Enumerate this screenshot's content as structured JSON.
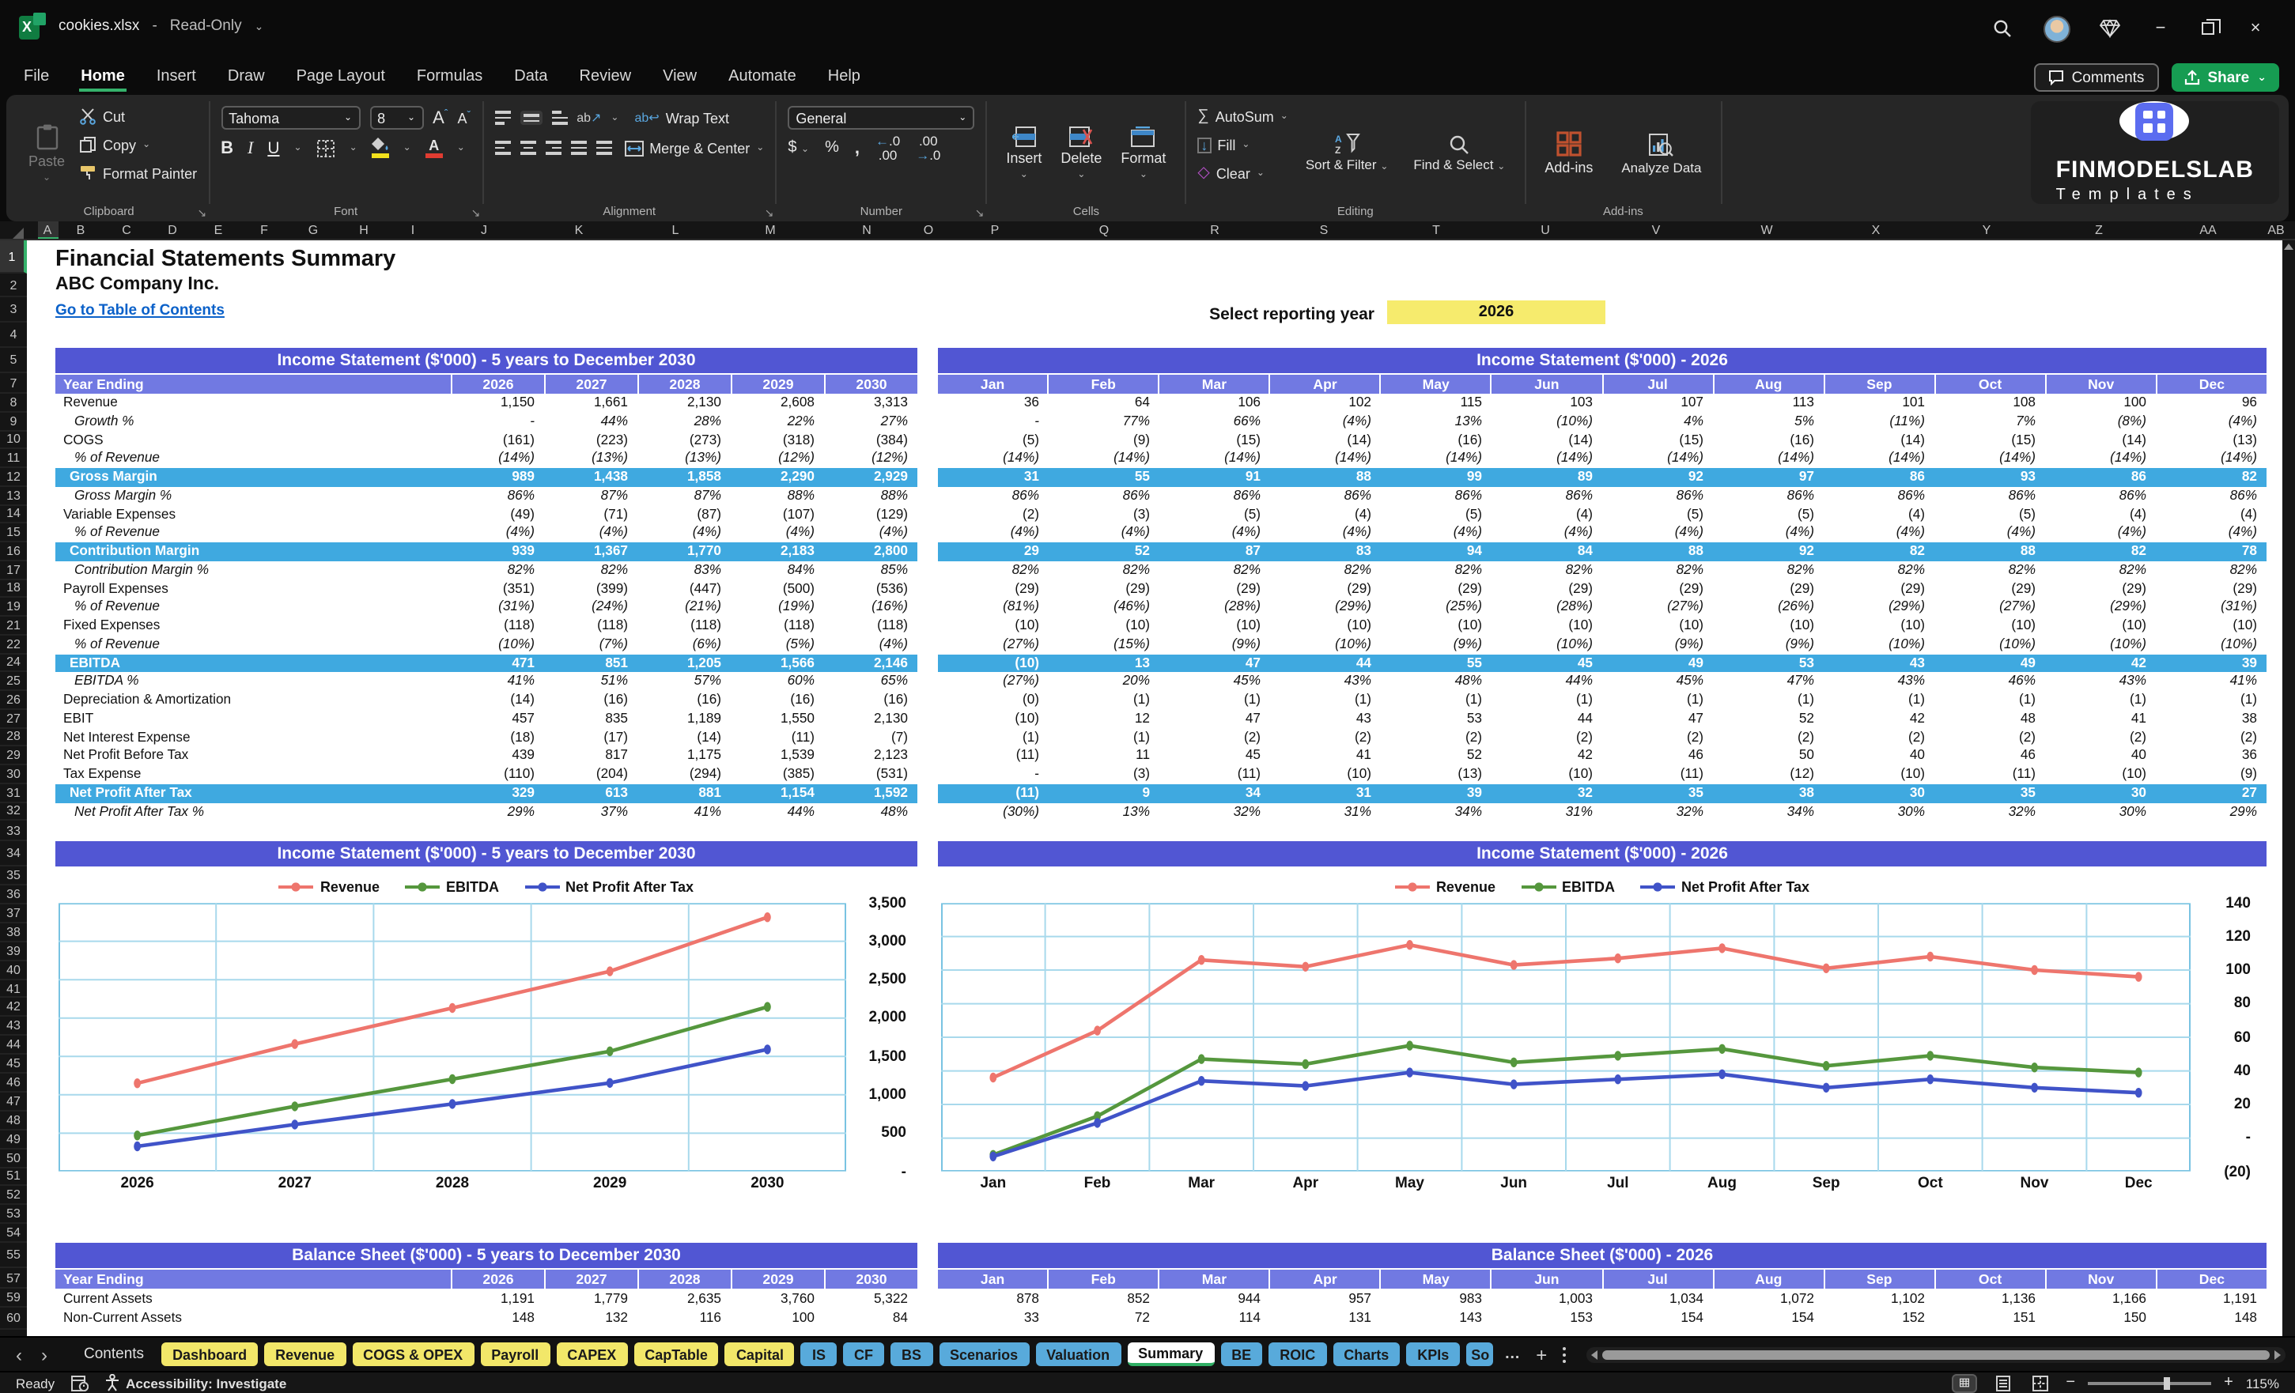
{
  "window": {
    "file": "cookies.xlsx",
    "dash": "-",
    "mode": "Read-Only"
  },
  "menu": {
    "items": [
      "File",
      "Home",
      "Insert",
      "Draw",
      "Page Layout",
      "Formulas",
      "Data",
      "Review",
      "View",
      "Automate",
      "Help"
    ],
    "active": "Home",
    "comments": "Comments",
    "share": "Share"
  },
  "ribbon": {
    "clipboard": {
      "label": "Clipboard",
      "paste": "Paste",
      "cut": "Cut",
      "copy": "Copy",
      "format_painter": "Format Painter"
    },
    "font": {
      "label": "Font",
      "font_name": "Tahoma",
      "font_size": "8"
    },
    "alignment": {
      "label": "Alignment",
      "wrap_text": "Wrap Text",
      "merge_center": "Merge & Center"
    },
    "number": {
      "label": "Number",
      "format": "General"
    },
    "cells": {
      "label": "Cells",
      "insert": "Insert",
      "delete": "Delete",
      "format": "Format"
    },
    "editing": {
      "label": "Editing",
      "autosum": "AutoSum",
      "fill": "Fill",
      "clear": "Clear",
      "sort_filter": "Sort & Filter",
      "find_select": "Find & Select"
    },
    "addins": {
      "label": "Add-ins",
      "addins": "Add-ins",
      "analyze": "Analyze Data"
    }
  },
  "brand": {
    "name": "FINMODELSLAB",
    "tagline": "Templates"
  },
  "reporting": {
    "label": "Select reporting year",
    "year": "2026",
    "year_cell_color": "#f6eb6d"
  },
  "colors": {
    "header_purple": "#5156d3",
    "subheader_purple": "#7179e2",
    "highlight_cyan": "#3fa9e0",
    "tab_yellow": "#f2e769",
    "tab_blue": "#58aadb",
    "excel_green": "#107c41",
    "share_green": "#169c52"
  },
  "icons": {
    "search-icon": "magnifier",
    "diamond-icon": "gem",
    "minimize-icon": "−",
    "restore-icon": "overlapping-squares",
    "close-icon": "×",
    "dropdown-chevron": "⌄",
    "autosum-icon": "∑",
    "fill-icon": "↓",
    "clear-icon": "◇",
    "tab-prev": "‹",
    "tab-next": "›",
    "more-tabs": "…",
    "add-sheet": "+"
  },
  "sheet": {
    "title": "Financial Statements Summary",
    "company": "ABC Company Inc.",
    "toc_link": "Go to Table of Contents",
    "column_letters": [
      "A",
      "B",
      "C",
      "D",
      "E",
      "F",
      "G",
      "H",
      "I",
      "J",
      "K",
      "L",
      "M",
      "N",
      "O",
      "P",
      "Q",
      "R",
      "S",
      "T",
      "U",
      "V",
      "W",
      "X",
      "Y",
      "Z",
      "AA",
      "AB"
    ],
    "row_numbers": [
      "1",
      "2",
      "3",
      "4",
      "5",
      "7",
      "8",
      "9",
      "10",
      "11",
      "12",
      "13",
      "14",
      "15",
      "16",
      "17",
      "18",
      "19",
      "21",
      "22",
      "24",
      "25",
      "26",
      "27",
      "28",
      "29",
      "30",
      "31",
      "32",
      "33",
      "34",
      "35",
      "36",
      "37",
      "38",
      "39",
      "40",
      "41",
      "42",
      "43",
      "44",
      "45",
      "46",
      "47",
      "48",
      "49",
      "50",
      "51",
      "52",
      "53",
      "54",
      "55",
      "57",
      "59",
      "60"
    ],
    "row_header": "Year Ending",
    "years": [
      "2026",
      "2027",
      "2028",
      "2029",
      "2030"
    ],
    "months": [
      "Jan",
      "Feb",
      "Mar",
      "Apr",
      "May",
      "Jun",
      "Jul",
      "Aug",
      "Sep",
      "Oct",
      "Nov",
      "Dec"
    ],
    "is_yearly_title": "Income Statement ($'000) - 5 years to December 2030",
    "is_monthly_title": "Income Statement ($'000) - 2026",
    "bs_yearly_title": "Balance Sheet ($'000) - 5 years to December 2030",
    "bs_monthly_title": "Balance Sheet ($'000) - 2026",
    "is_rows": [
      {
        "label": "Revenue",
        "style": "n",
        "y": [
          "1,150",
          "1,661",
          "2,130",
          "2,608",
          "3,313"
        ],
        "m": [
          "36",
          "64",
          "106",
          "102",
          "115",
          "103",
          "107",
          "113",
          "101",
          "108",
          "100",
          "96"
        ]
      },
      {
        "label": "Growth %",
        "style": "p",
        "y": [
          "-",
          "44%",
          "28%",
          "22%",
          "27%"
        ],
        "m": [
          "-",
          "77%",
          "66%",
          "(4%)",
          "13%",
          "(10%)",
          "4%",
          "5%",
          "(11%)",
          "7%",
          "(8%)",
          "(4%)"
        ]
      },
      {
        "label": "COGS",
        "style": "n",
        "y": [
          "(161)",
          "(223)",
          "(273)",
          "(318)",
          "(384)"
        ],
        "m": [
          "(5)",
          "(9)",
          "(15)",
          "(14)",
          "(16)",
          "(14)",
          "(15)",
          "(16)",
          "(14)",
          "(15)",
          "(14)",
          "(13)"
        ]
      },
      {
        "label": "% of Revenue",
        "style": "p",
        "y": [
          "(14%)",
          "(13%)",
          "(13%)",
          "(12%)",
          "(12%)"
        ],
        "m": [
          "(14%)",
          "(14%)",
          "(14%)",
          "(14%)",
          "(14%)",
          "(14%)",
          "(14%)",
          "(14%)",
          "(14%)",
          "(14%)",
          "(14%)",
          "(14%)"
        ]
      },
      {
        "label": "Gross Margin",
        "style": "h",
        "y": [
          "989",
          "1,438",
          "1,858",
          "2,290",
          "2,929"
        ],
        "m": [
          "31",
          "55",
          "91",
          "88",
          "99",
          "89",
          "92",
          "97",
          "86",
          "93",
          "86",
          "82"
        ]
      },
      {
        "label": "Gross Margin %",
        "style": "p",
        "y": [
          "86%",
          "87%",
          "87%",
          "88%",
          "88%"
        ],
        "m": [
          "86%",
          "86%",
          "86%",
          "86%",
          "86%",
          "86%",
          "86%",
          "86%",
          "86%",
          "86%",
          "86%",
          "86%"
        ]
      },
      {
        "label": "Variable Expenses",
        "style": "n",
        "y": [
          "(49)",
          "(71)",
          "(87)",
          "(107)",
          "(129)"
        ],
        "m": [
          "(2)",
          "(3)",
          "(5)",
          "(4)",
          "(5)",
          "(4)",
          "(5)",
          "(5)",
          "(4)",
          "(5)",
          "(4)",
          "(4)"
        ]
      },
      {
        "label": "% of Revenue",
        "style": "p",
        "y": [
          "(4%)",
          "(4%)",
          "(4%)",
          "(4%)",
          "(4%)"
        ],
        "m": [
          "(4%)",
          "(4%)",
          "(4%)",
          "(4%)",
          "(4%)",
          "(4%)",
          "(4%)",
          "(4%)",
          "(4%)",
          "(4%)",
          "(4%)",
          "(4%)"
        ]
      },
      {
        "label": "Contribution Margin",
        "style": "h",
        "y": [
          "939",
          "1,367",
          "1,770",
          "2,183",
          "2,800"
        ],
        "m": [
          "29",
          "52",
          "87",
          "83",
          "94",
          "84",
          "88",
          "92",
          "82",
          "88",
          "82",
          "78"
        ]
      },
      {
        "label": "Contribution Margin %",
        "style": "p",
        "y": [
          "82%",
          "82%",
          "83%",
          "84%",
          "85%"
        ],
        "m": [
          "82%",
          "82%",
          "82%",
          "82%",
          "82%",
          "82%",
          "82%",
          "82%",
          "82%",
          "82%",
          "82%",
          "82%"
        ]
      },
      {
        "label": "Payroll Expenses",
        "style": "n",
        "y": [
          "(351)",
          "(399)",
          "(447)",
          "(500)",
          "(536)"
        ],
        "m": [
          "(29)",
          "(29)",
          "(29)",
          "(29)",
          "(29)",
          "(29)",
          "(29)",
          "(29)",
          "(29)",
          "(29)",
          "(29)",
          "(29)"
        ]
      },
      {
        "label": "% of Revenue",
        "style": "p",
        "y": [
          "(31%)",
          "(24%)",
          "(21%)",
          "(19%)",
          "(16%)"
        ],
        "m": [
          "(81%)",
          "(46%)",
          "(28%)",
          "(29%)",
          "(25%)",
          "(28%)",
          "(27%)",
          "(26%)",
          "(29%)",
          "(27%)",
          "(29%)",
          "(31%)"
        ]
      },
      {
        "label": "Fixed Expenses",
        "style": "n",
        "y": [
          "(118)",
          "(118)",
          "(118)",
          "(118)",
          "(118)"
        ],
        "m": [
          "(10)",
          "(10)",
          "(10)",
          "(10)",
          "(10)",
          "(10)",
          "(10)",
          "(10)",
          "(10)",
          "(10)",
          "(10)",
          "(10)"
        ]
      },
      {
        "label": "% of Revenue",
        "style": "p",
        "y": [
          "(10%)",
          "(7%)",
          "(6%)",
          "(5%)",
          "(4%)"
        ],
        "m": [
          "(27%)",
          "(15%)",
          "(9%)",
          "(10%)",
          "(9%)",
          "(10%)",
          "(9%)",
          "(9%)",
          "(10%)",
          "(10%)",
          "(10%)",
          "(10%)"
        ]
      },
      {
        "label": "EBITDA",
        "style": "h",
        "y": [
          "471",
          "851",
          "1,205",
          "1,566",
          "2,146"
        ],
        "m": [
          "(10)",
          "13",
          "47",
          "44",
          "55",
          "45",
          "49",
          "53",
          "43",
          "49",
          "42",
          "39"
        ]
      },
      {
        "label": "EBITDA %",
        "style": "p",
        "y": [
          "41%",
          "51%",
          "57%",
          "60%",
          "65%"
        ],
        "m": [
          "(27%)",
          "20%",
          "45%",
          "43%",
          "48%",
          "44%",
          "45%",
          "47%",
          "43%",
          "46%",
          "43%",
          "41%"
        ]
      },
      {
        "label": "Depreciation & Amortization",
        "style": "n",
        "y": [
          "(14)",
          "(16)",
          "(16)",
          "(16)",
          "(16)"
        ],
        "m": [
          "(0)",
          "(1)",
          "(1)",
          "(1)",
          "(1)",
          "(1)",
          "(1)",
          "(1)",
          "(1)",
          "(1)",
          "(1)",
          "(1)"
        ]
      },
      {
        "label": "EBIT",
        "style": "n",
        "y": [
          "457",
          "835",
          "1,189",
          "1,550",
          "2,130"
        ],
        "m": [
          "(10)",
          "12",
          "47",
          "43",
          "53",
          "44",
          "47",
          "52",
          "42",
          "48",
          "41",
          "38"
        ]
      },
      {
        "label": "Net Interest Expense",
        "style": "n",
        "y": [
          "(18)",
          "(17)",
          "(14)",
          "(11)",
          "(7)"
        ],
        "m": [
          "(1)",
          "(1)",
          "(2)",
          "(2)",
          "(2)",
          "(2)",
          "(2)",
          "(2)",
          "(2)",
          "(2)",
          "(2)",
          "(2)"
        ]
      },
      {
        "label": "Net Profit Before Tax",
        "style": "n",
        "y": [
          "439",
          "817",
          "1,175",
          "1,539",
          "2,123"
        ],
        "m": [
          "(11)",
          "11",
          "45",
          "41",
          "52",
          "42",
          "46",
          "50",
          "40",
          "46",
          "40",
          "36"
        ]
      },
      {
        "label": "Tax Expense",
        "style": "n",
        "y": [
          "(110)",
          "(204)",
          "(294)",
          "(385)",
          "(531)"
        ],
        "m": [
          "-",
          "(3)",
          "(11)",
          "(10)",
          "(13)",
          "(10)",
          "(11)",
          "(12)",
          "(10)",
          "(11)",
          "(10)",
          "(9)"
        ]
      },
      {
        "label": "Net Profit After Tax",
        "style": "h",
        "y": [
          "329",
          "613",
          "881",
          "1,154",
          "1,592"
        ],
        "m": [
          "(11)",
          "9",
          "34",
          "31",
          "39",
          "32",
          "35",
          "38",
          "30",
          "35",
          "30",
          "27"
        ]
      },
      {
        "label": "Net Profit After Tax %",
        "style": "p",
        "y": [
          "29%",
          "37%",
          "41%",
          "44%",
          "48%"
        ],
        "m": [
          "(30%)",
          "13%",
          "32%",
          "31%",
          "34%",
          "31%",
          "32%",
          "34%",
          "30%",
          "32%",
          "30%",
          "29%"
        ]
      }
    ],
    "bs_rows": [
      {
        "label": "Current Assets",
        "style": "n",
        "y": [
          "1,191",
          "1,779",
          "2,635",
          "3,760",
          "5,322"
        ],
        "m": [
          "878",
          "852",
          "944",
          "957",
          "983",
          "1,003",
          "1,034",
          "1,072",
          "1,102",
          "1,136",
          "1,166",
          "1,191"
        ]
      },
      {
        "label": "Non-Current Assets",
        "style": "n",
        "y": [
          "148",
          "132",
          "116",
          "100",
          "84"
        ],
        "m": [
          "33",
          "72",
          "114",
          "131",
          "143",
          "153",
          "154",
          "154",
          "152",
          "151",
          "150",
          "148"
        ]
      }
    ]
  },
  "chart_data": [
    {
      "type": "line",
      "title": "Income Statement ($'000) - 5 years to December 2030",
      "categories": [
        "2026",
        "2027",
        "2028",
        "2029",
        "2030"
      ],
      "series": [
        {
          "name": "Revenue",
          "color": "#ee756d",
          "values": [
            1150,
            1661,
            2130,
            2608,
            3313
          ]
        },
        {
          "name": "EBITDA",
          "color": "#55973d",
          "values": [
            471,
            851,
            1205,
            1566,
            2146
          ]
        },
        {
          "name": "Net Profit After Tax",
          "color": "#4053c8",
          "values": [
            329,
            613,
            881,
            1154,
            1592
          ]
        }
      ],
      "ylim": [
        0,
        3500
      ],
      "ystep": 500,
      "ytick_labels": [
        "3,500",
        "3,000",
        "2,500",
        "2,000",
        "1,500",
        "1,000",
        "500",
        "-"
      ],
      "legend_position": "top",
      "y_axis_side": "right",
      "grid": true
    },
    {
      "type": "line",
      "title": "Income Statement ($'000) - 2026",
      "categories": [
        "Jan",
        "Feb",
        "Mar",
        "Apr",
        "May",
        "Jun",
        "Jul",
        "Aug",
        "Sep",
        "Oct",
        "Nov",
        "Dec"
      ],
      "series": [
        {
          "name": "Revenue",
          "color": "#ee756d",
          "values": [
            36,
            64,
            106,
            102,
            115,
            103,
            107,
            113,
            101,
            108,
            100,
            96
          ]
        },
        {
          "name": "EBITDA",
          "color": "#55973d",
          "values": [
            -10,
            13,
            47,
            44,
            55,
            45,
            49,
            53,
            43,
            49,
            42,
            39
          ]
        },
        {
          "name": "Net Profit After Tax",
          "color": "#4053c8",
          "values": [
            -11,
            9,
            34,
            31,
            39,
            32,
            35,
            38,
            30,
            35,
            30,
            27
          ]
        }
      ],
      "ylim": [
        -20,
        140
      ],
      "ystep": 20,
      "ytick_labels": [
        "140",
        "120",
        "100",
        "80",
        "60",
        "40",
        "20",
        "-",
        "(20)"
      ],
      "legend_position": "top",
      "y_axis_side": "right",
      "grid": true
    }
  ],
  "sheet_tabs": {
    "tabs": [
      {
        "label": "Contents",
        "type": "plain"
      },
      {
        "label": "Dashboard",
        "type": "yellow"
      },
      {
        "label": "Revenue",
        "type": "yellow"
      },
      {
        "label": "COGS & OPEX",
        "type": "yellow"
      },
      {
        "label": "Payroll",
        "type": "yellow"
      },
      {
        "label": "CAPEX",
        "type": "yellow"
      },
      {
        "label": "CapTable",
        "type": "yellow"
      },
      {
        "label": "Capital",
        "type": "yellow"
      },
      {
        "label": "IS",
        "type": "blue"
      },
      {
        "label": "CF",
        "type": "blue"
      },
      {
        "label": "BS",
        "type": "blue"
      },
      {
        "label": "Scenarios",
        "type": "blue"
      },
      {
        "label": "Valuation",
        "type": "blue"
      },
      {
        "label": "Summary",
        "type": "active"
      },
      {
        "label": "BE",
        "type": "blue"
      },
      {
        "label": "ROIC",
        "type": "blue"
      },
      {
        "label": "Charts",
        "type": "blue"
      },
      {
        "label": "KPIs",
        "type": "blue"
      },
      {
        "label": "So",
        "type": "blue-clip"
      }
    ]
  },
  "status": {
    "ready": "Ready",
    "accessibility": "Accessibility: Investigate",
    "zoom": "115%"
  }
}
